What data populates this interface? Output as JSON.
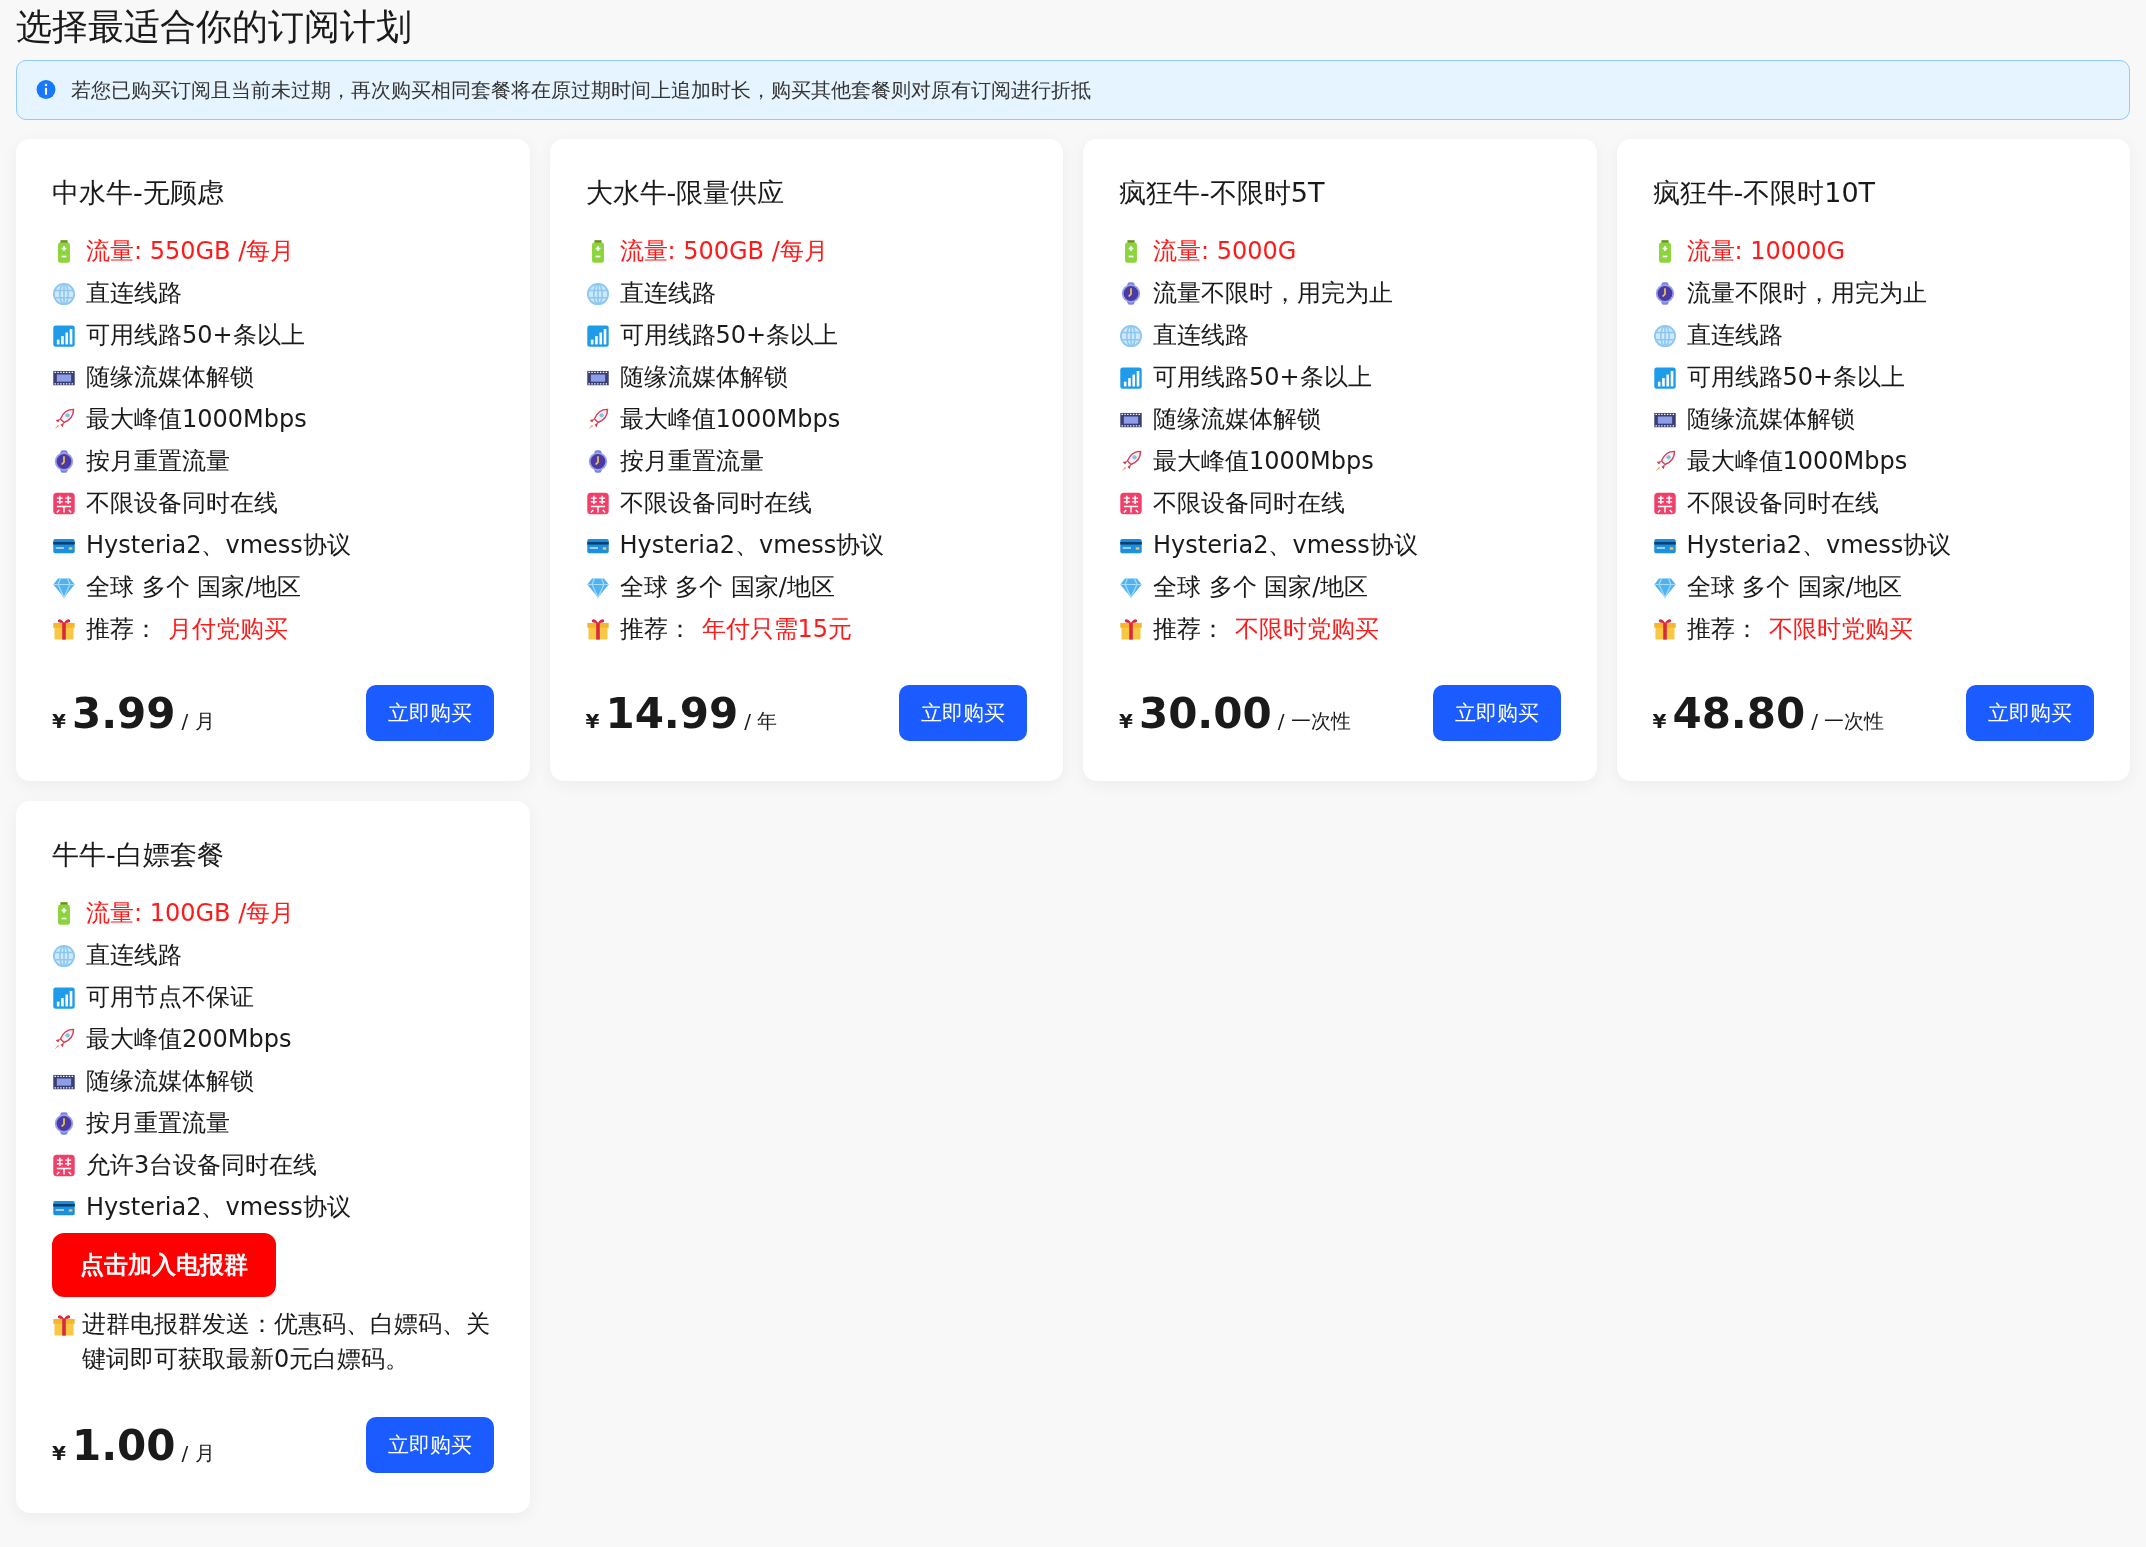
{
  "page_title": "选择最适合你的订阅计划",
  "notice": {
    "text": "若您已购买订阅且当前未过期，再次购买相同套餐将在原过期时间上追加时长，购买其他套餐则对原有订阅进行折抵"
  },
  "plans": [
    {
      "name": "中水牛-无顾虑",
      "features": [
        {
          "kind": "battery",
          "label": "流量: 550GB /每月",
          "emphasis": true
        },
        {
          "kind": "globe",
          "label": "直连线路"
        },
        {
          "kind": "signal",
          "label": "可用线路50+条以上"
        },
        {
          "kind": "film",
          "label": "随缘流媒体解锁"
        },
        {
          "kind": "rocket",
          "label": "最大峰值1000Mbps"
        },
        {
          "kind": "watch",
          "label": "按月重置流量"
        },
        {
          "kind": "forbidden",
          "label": "不限设备同时在线"
        },
        {
          "kind": "card",
          "label": "Hysteria2、vmess协议"
        },
        {
          "kind": "diamond",
          "label": "全球 多个 国家/地区"
        },
        {
          "kind": "gift",
          "label": "推荐：",
          "note": "月付党购买"
        }
      ],
      "currency": "¥",
      "price": "3.99",
      "period": "/ 月",
      "button": "立即购买"
    },
    {
      "name": "大水牛-限量供应",
      "features": [
        {
          "kind": "battery",
          "label": "流量: 500GB /每月",
          "emphasis": true
        },
        {
          "kind": "globe",
          "label": "直连线路"
        },
        {
          "kind": "signal",
          "label": "可用线路50+条以上"
        },
        {
          "kind": "film",
          "label": "随缘流媒体解锁"
        },
        {
          "kind": "rocket",
          "label": "最大峰值1000Mbps"
        },
        {
          "kind": "watch",
          "label": "按月重置流量"
        },
        {
          "kind": "forbidden",
          "label": "不限设备同时在线"
        },
        {
          "kind": "card",
          "label": "Hysteria2、vmess协议"
        },
        {
          "kind": "diamond",
          "label": "全球 多个 国家/地区"
        },
        {
          "kind": "gift",
          "label": "推荐：",
          "note": "年付只需15元"
        }
      ],
      "currency": "¥",
      "price": "14.99",
      "period": "/ 年",
      "button": "立即购买"
    },
    {
      "name": "疯狂牛-不限时5T",
      "features": [
        {
          "kind": "battery",
          "label": "流量: 5000G",
          "emphasis": true
        },
        {
          "kind": "watch",
          "label": "流量不限时，用完为止"
        },
        {
          "kind": "globe",
          "label": "直连线路"
        },
        {
          "kind": "signal",
          "label": "可用线路50+条以上"
        },
        {
          "kind": "film",
          "label": "随缘流媒体解锁"
        },
        {
          "kind": "rocket",
          "label": "最大峰值1000Mbps"
        },
        {
          "kind": "forbidden",
          "label": "不限设备同时在线"
        },
        {
          "kind": "card",
          "label": "Hysteria2、vmess协议"
        },
        {
          "kind": "diamond",
          "label": "全球 多个 国家/地区"
        },
        {
          "kind": "gift",
          "label": "推荐：",
          "note": "不限时党购买"
        }
      ],
      "currency": "¥",
      "price": "30.00",
      "period": "/ 一次性",
      "button": "立即购买"
    },
    {
      "name": "疯狂牛-不限时10T",
      "features": [
        {
          "kind": "battery",
          "label": "流量: 10000G",
          "emphasis": true
        },
        {
          "kind": "watch",
          "label": "流量不限时，用完为止"
        },
        {
          "kind": "globe",
          "label": "直连线路"
        },
        {
          "kind": "signal",
          "label": "可用线路50+条以上"
        },
        {
          "kind": "film",
          "label": "随缘流媒体解锁"
        },
        {
          "kind": "rocket",
          "label": "最大峰值1000Mbps"
        },
        {
          "kind": "forbidden",
          "label": "不限设备同时在线"
        },
        {
          "kind": "card",
          "label": "Hysteria2、vmess协议"
        },
        {
          "kind": "diamond",
          "label": "全球 多个 国家/地区"
        },
        {
          "kind": "gift",
          "label": "推荐：",
          "note": "不限时党购买"
        }
      ],
      "currency": "¥",
      "price": "48.80",
      "period": "/ 一次性",
      "button": "立即购买"
    },
    {
      "name": "牛牛-白嫖套餐",
      "features": [
        {
          "kind": "battery",
          "label": "流量: 100GB /每月",
          "emphasis": true
        },
        {
          "kind": "globe",
          "label": "直连线路"
        },
        {
          "kind": "signal",
          "label": "可用节点不保证"
        },
        {
          "kind": "rocket",
          "label": "最大峰值200Mbps"
        },
        {
          "kind": "film",
          "label": "随缘流媒体解锁"
        },
        {
          "kind": "watch",
          "label": "按月重置流量"
        },
        {
          "kind": "forbidden",
          "label": "允许3台设备同时在线"
        },
        {
          "kind": "card",
          "label": "Hysteria2、vmess协议"
        }
      ],
      "group_button": "点击加入电报群",
      "group_note": {
        "kind": "gift",
        "text": "进群电报群发送：优惠码、白嫖码、关键词即可获取最新0元白嫖码。"
      },
      "currency": "¥",
      "price": "1.00",
      "period": "/ 月",
      "button": "立即购买"
    }
  ]
}
